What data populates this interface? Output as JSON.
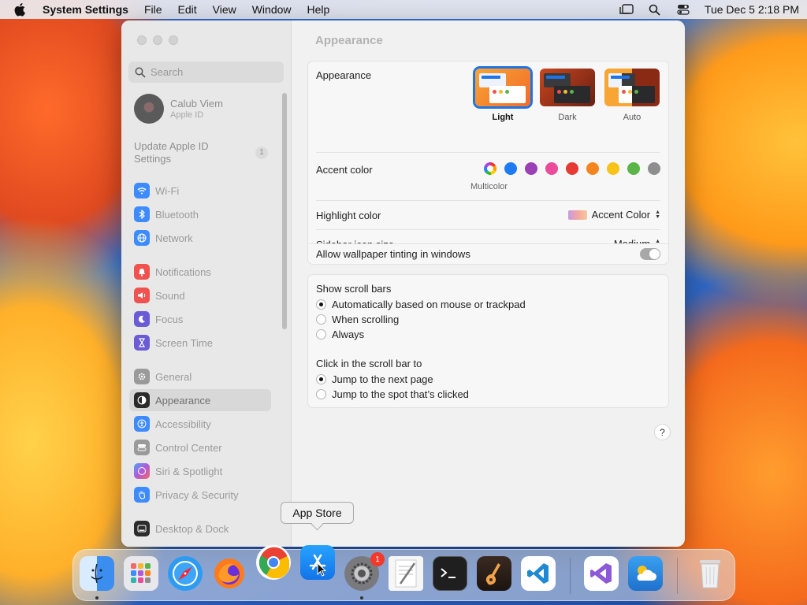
{
  "menubar": {
    "app_name": "System Settings",
    "items": [
      "File",
      "Edit",
      "View",
      "Window",
      "Help"
    ],
    "clock": "Tue Dec 5  2:18 PM"
  },
  "sidebar": {
    "search_placeholder": "Search",
    "profile": {
      "name": "Calub Viem",
      "subtitle": "Apple ID"
    },
    "update": {
      "label": "Update Apple ID Settings",
      "badge": "1"
    },
    "items": [
      {
        "label": "Wi-Fi",
        "icon": "wifi-icon",
        "color": "#3d8bfd"
      },
      {
        "label": "Bluetooth",
        "icon": "bluetooth-icon",
        "color": "#3d8bfd"
      },
      {
        "label": "Network",
        "icon": "globe-icon",
        "color": "#3d8bfd"
      },
      {
        "label": "Notifications",
        "icon": "bell-icon",
        "color": "#f0524f"
      },
      {
        "label": "Sound",
        "icon": "speaker-icon",
        "color": "#f0524f"
      },
      {
        "label": "Focus",
        "icon": "moon-icon",
        "color": "#6b5cd6"
      },
      {
        "label": "Screen Time",
        "icon": "hourglass-icon",
        "color": "#6b5cd6"
      },
      {
        "label": "General",
        "icon": "gear-icon",
        "color": "#9a9a9a"
      },
      {
        "label": "Appearance",
        "icon": "appearance-icon",
        "color": "#2b2b2b"
      },
      {
        "label": "Accessibility",
        "icon": "accessibility-icon",
        "color": "#3d8bfd"
      },
      {
        "label": "Control Center",
        "icon": "control-center-icon",
        "color": "#9a9a9a"
      },
      {
        "label": "Siri & Spotlight",
        "icon": "siri-icon",
        "color": "#b05ad8"
      },
      {
        "label": "Privacy & Security",
        "icon": "hand-icon",
        "color": "#3d8bfd"
      },
      {
        "label": "Desktop & Dock",
        "icon": "dock-icon",
        "color": "#2b2b2b"
      }
    ]
  },
  "main": {
    "title": "Appearance",
    "appearance_label": "Appearance",
    "themes": [
      "Light",
      "Dark",
      "Auto"
    ],
    "accent_label": "Accent color",
    "accent_colors": [
      "multicolor",
      "#1d7cf2",
      "#9b40b5",
      "#ea4b9a",
      "#e63a33",
      "#f5851f",
      "#f7c319",
      "#5ab548",
      "#8e8e8e"
    ],
    "multicolor_label": "Multicolor",
    "highlight_label": "Highlight color",
    "highlight_value": "Accent Color",
    "sidebar_icon_label": "Sidebar icon size",
    "sidebar_icon_value": "Medium",
    "tinting_label": "Allow wallpaper tinting in windows",
    "scroll_bars_label": "Show scroll bars",
    "scroll_bars_options": [
      "Automatically based on mouse or trackpad",
      "When scrolling",
      "Always"
    ],
    "click_label": "Click in the scroll bar to",
    "click_options": [
      "Jump to the next page",
      "Jump to the spot that’s clicked"
    ],
    "help": "?"
  },
  "tooltip": "App Store",
  "dock": {
    "apps": [
      {
        "name": "Finder",
        "icon": "finder-icon",
        "color": "#3b8df0"
      },
      {
        "name": "Launchpad",
        "icon": "launchpad-icon",
        "color": "#e8e8ec"
      },
      {
        "name": "Safari",
        "icon": "safari-icon",
        "color": "#2f9bf0"
      },
      {
        "name": "Firefox",
        "icon": "firefox-icon",
        "color": "#ff7a1a"
      },
      {
        "name": "Chrome",
        "icon": "chrome-icon",
        "color": "#ffffff"
      },
      {
        "name": "App Store",
        "icon": "app-store-icon",
        "color": "#1d8cf5"
      },
      {
        "name": "System Settings",
        "icon": "system-settings-icon",
        "color": "#8a8a8e"
      },
      {
        "name": "TextEdit",
        "icon": "textedit-icon",
        "color": "#f6f6f6"
      },
      {
        "name": "Terminal",
        "icon": "terminal-icon",
        "color": "#1f1f1f"
      },
      {
        "name": "GarageBand",
        "icon": "garageband-icon",
        "color": "#3a2a22"
      },
      {
        "name": "Visual Studio Code",
        "icon": "vscode-icon",
        "color": "#ffffff"
      },
      {
        "name": "Visual Studio",
        "icon": "visual-studio-icon",
        "color": "#ffffff"
      },
      {
        "name": "Weather",
        "icon": "weather-icon",
        "color": "#2f8ae6"
      },
      {
        "name": "Trash",
        "icon": "trash-icon",
        "color": "#e6e8ea"
      }
    ],
    "settings_badge": "1"
  }
}
